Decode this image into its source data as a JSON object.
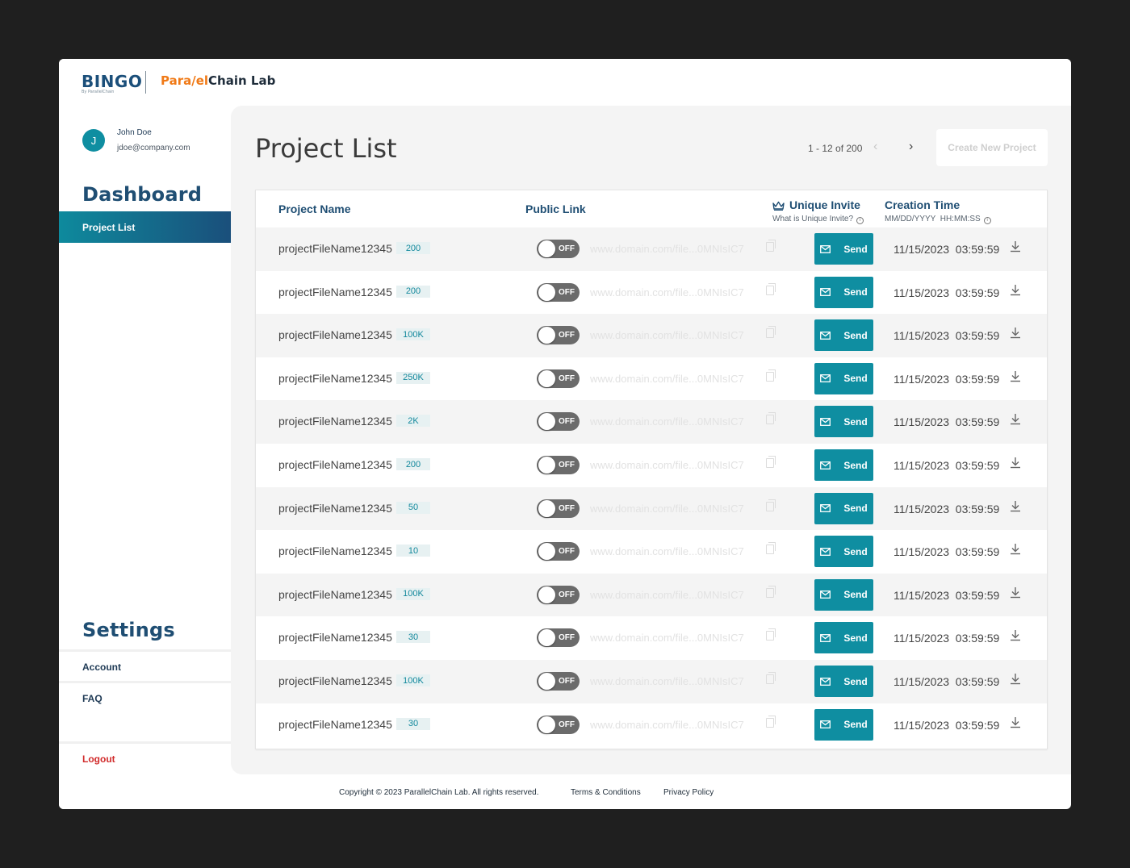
{
  "brand": {
    "bingo": "BINGO",
    "bingo_sub": "By ParallelChain",
    "pcl_prefix": "Para",
    "pcl_slash": "/",
    "pcl_mid": "el",
    "pcl_suffix": "Chain Lab"
  },
  "user": {
    "initial": "J",
    "name": "John Doe",
    "email": "jdoe@company.com"
  },
  "sidebar": {
    "dashboard_heading": "Dashboard",
    "active_item": "Project List",
    "settings_heading": "Settings",
    "account": "Account",
    "faq": "FAQ",
    "logout": "Logout"
  },
  "main": {
    "title": "Project List",
    "pager_text": "1 - 12 of 200",
    "create_button": "Create New Project"
  },
  "table": {
    "headers": {
      "project_name": "Project Name",
      "public_link": "Public Link",
      "unique_invite": "Unique Invite",
      "unique_invite_sub": "What is Unique Invite?",
      "creation_time": "Creation Time",
      "creation_time_sub": "MM/DD/YYYY  HH:MM:SS"
    },
    "toggle_label": "OFF",
    "send_label": "Send",
    "rows": [
      {
        "name": "projectFileName12345",
        "count": "200",
        "link": "www.domain.com/file...0MNIsIC7",
        "time": "11/15/2023  03:59:59"
      },
      {
        "name": "projectFileName12345",
        "count": "200",
        "link": "www.domain.com/file...0MNIsIC7",
        "time": "11/15/2023  03:59:59"
      },
      {
        "name": "projectFileName12345",
        "count": "100K",
        "link": "www.domain.com/file...0MNIsIC7",
        "time": "11/15/2023  03:59:59"
      },
      {
        "name": "projectFileName12345",
        "count": "250K",
        "link": "www.domain.com/file...0MNIsIC7",
        "time": "11/15/2023  03:59:59"
      },
      {
        "name": "projectFileName12345",
        "count": "2K",
        "link": "www.domain.com/file...0MNIsIC7",
        "time": "11/15/2023  03:59:59"
      },
      {
        "name": "projectFileName12345",
        "count": "200",
        "link": "www.domain.com/file...0MNIsIC7",
        "time": "11/15/2023  03:59:59"
      },
      {
        "name": "projectFileName12345",
        "count": "50",
        "link": "www.domain.com/file...0MNIsIC7",
        "time": "11/15/2023  03:59:59"
      },
      {
        "name": "projectFileName12345",
        "count": "10",
        "link": "www.domain.com/file...0MNIsIC7",
        "time": "11/15/2023  03:59:59"
      },
      {
        "name": "projectFileName12345",
        "count": "100K",
        "link": "www.domain.com/file...0MNIsIC7",
        "time": "11/15/2023  03:59:59"
      },
      {
        "name": "projectFileName12345",
        "count": "30",
        "link": "www.domain.com/file...0MNIsIC7",
        "time": "11/15/2023  03:59:59"
      },
      {
        "name": "projectFileName12345",
        "count": "100K",
        "link": "www.domain.com/file...0MNIsIC7",
        "time": "11/15/2023  03:59:59"
      },
      {
        "name": "projectFileName12345",
        "count": "30",
        "link": "www.domain.com/file...0MNIsIC7",
        "time": "11/15/2023  03:59:59"
      }
    ]
  },
  "footer": {
    "copyright": "Copyright © 2023 ParallelChain Lab. All rights reserved.",
    "terms": "Terms & Conditions",
    "privacy": "Privacy Policy"
  },
  "colors": {
    "accent": "#0f8ea1",
    "navy": "#1f4e73",
    "logout": "#d12b2b",
    "brand_orange": "#f07a17"
  }
}
